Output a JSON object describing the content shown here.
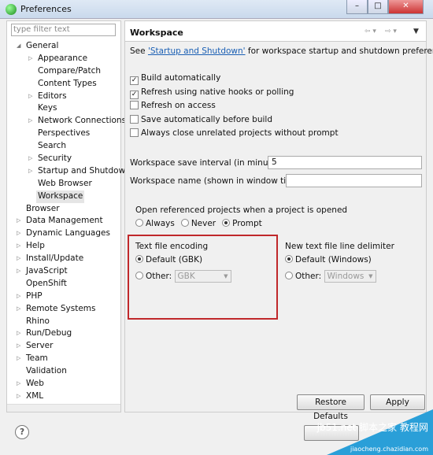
{
  "window": {
    "title": "Preferences",
    "minimize": "–",
    "maximize": "□",
    "close": "✕"
  },
  "sidebar": {
    "filter_placeholder": "type filter text",
    "items": [
      {
        "label": "General",
        "level": 0,
        "arrow": "expanded"
      },
      {
        "label": "Appearance",
        "level": 1,
        "arrow": "collapsed"
      },
      {
        "label": "Compare/Patch",
        "level": 1,
        "arrow": ""
      },
      {
        "label": "Content Types",
        "level": 1,
        "arrow": ""
      },
      {
        "label": "Editors",
        "level": 1,
        "arrow": "collapsed"
      },
      {
        "label": "Keys",
        "level": 1,
        "arrow": ""
      },
      {
        "label": "Network Connections",
        "level": 1,
        "arrow": "collapsed"
      },
      {
        "label": "Perspectives",
        "level": 1,
        "arrow": ""
      },
      {
        "label": "Search",
        "level": 1,
        "arrow": ""
      },
      {
        "label": "Security",
        "level": 1,
        "arrow": "collapsed"
      },
      {
        "label": "Startup and Shutdow",
        "level": 1,
        "arrow": "collapsed"
      },
      {
        "label": "Web Browser",
        "level": 1,
        "arrow": ""
      },
      {
        "label": "Workspace",
        "level": 1,
        "arrow": "",
        "selected": true
      },
      {
        "label": "Browser",
        "level": 0,
        "arrow": ""
      },
      {
        "label": "Data Management",
        "level": 0,
        "arrow": "collapsed"
      },
      {
        "label": "Dynamic Languages",
        "level": 0,
        "arrow": "collapsed"
      },
      {
        "label": "Help",
        "level": 0,
        "arrow": "collapsed"
      },
      {
        "label": "Install/Update",
        "level": 0,
        "arrow": "collapsed"
      },
      {
        "label": "JavaScript",
        "level": 0,
        "arrow": "collapsed"
      },
      {
        "label": "OpenShift",
        "level": 0,
        "arrow": ""
      },
      {
        "label": "PHP",
        "level": 0,
        "arrow": "collapsed"
      },
      {
        "label": "Remote Systems",
        "level": 0,
        "arrow": "collapsed"
      },
      {
        "label": "Rhino",
        "level": 0,
        "arrow": ""
      },
      {
        "label": "Run/Debug",
        "level": 0,
        "arrow": "collapsed"
      },
      {
        "label": "Server",
        "level": 0,
        "arrow": "collapsed"
      },
      {
        "label": "Team",
        "level": 0,
        "arrow": "collapsed"
      },
      {
        "label": "Validation",
        "level": 0,
        "arrow": ""
      },
      {
        "label": "Web",
        "level": 0,
        "arrow": "collapsed"
      },
      {
        "label": "XML",
        "level": 0,
        "arrow": "collapsed"
      }
    ]
  },
  "main": {
    "title": "Workspace",
    "intro_pre": "See ",
    "intro_link": "'Startup and Shutdown'",
    "intro_post": " for workspace startup and shutdown preferences.",
    "checkboxes": [
      {
        "label": "Build automatically",
        "checked": true
      },
      {
        "label": "Refresh using native hooks or polling",
        "checked": true
      },
      {
        "label": "Refresh on access",
        "checked": false
      },
      {
        "label": "Save automatically before build",
        "checked": false
      },
      {
        "label": "Always close unrelated projects without prompt",
        "checked": false
      }
    ],
    "save_interval_label": "Workspace save interval (in minutes):",
    "save_interval_value": "5",
    "name_label": "Workspace name (shown in window title):",
    "name_value": "",
    "open_projects_label": "Open referenced projects when a project is opened",
    "open_options": [
      {
        "label": "Always",
        "selected": false
      },
      {
        "label": "Never",
        "selected": false
      },
      {
        "label": "Prompt",
        "selected": true
      }
    ],
    "encoding": {
      "label": "Text file encoding",
      "default_label": "Default (GBK)",
      "other_label": "Other:",
      "other_value": "GBK",
      "selected": "default"
    },
    "delimiter": {
      "label": "New text file line delimiter",
      "default_label": "Default (Windows)",
      "other_label": "Other:",
      "other_value": "Windows",
      "selected": "default"
    },
    "restore_defaults": "Restore Defaults",
    "apply": "Apply"
  },
  "footer": {
    "help": "?"
  },
  "watermark": {
    "text": "jb51.net 脚本之家 教程网",
    "sub": "jiaocheng.chazidian.com"
  },
  "colors": {
    "highlight": "#c0282b",
    "link": "#1a5fb4"
  }
}
